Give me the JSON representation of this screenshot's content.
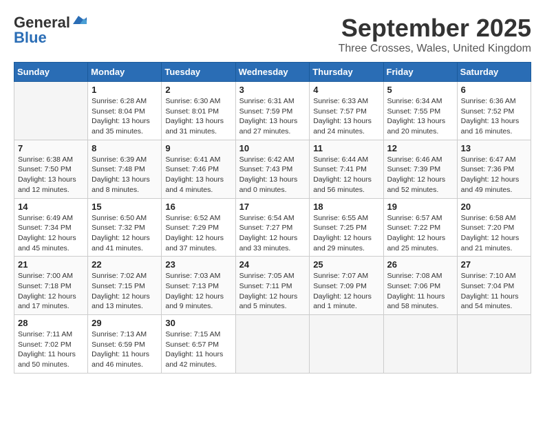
{
  "header": {
    "logo_line1": "General",
    "logo_line2": "Blue",
    "month": "September 2025",
    "location": "Three Crosses, Wales, United Kingdom"
  },
  "days_of_week": [
    "Sunday",
    "Monday",
    "Tuesday",
    "Wednesday",
    "Thursday",
    "Friday",
    "Saturday"
  ],
  "weeks": [
    [
      {
        "day": "",
        "info": ""
      },
      {
        "day": "1",
        "info": "Sunrise: 6:28 AM\nSunset: 8:04 PM\nDaylight: 13 hours\nand 35 minutes."
      },
      {
        "day": "2",
        "info": "Sunrise: 6:30 AM\nSunset: 8:01 PM\nDaylight: 13 hours\nand 31 minutes."
      },
      {
        "day": "3",
        "info": "Sunrise: 6:31 AM\nSunset: 7:59 PM\nDaylight: 13 hours\nand 27 minutes."
      },
      {
        "day": "4",
        "info": "Sunrise: 6:33 AM\nSunset: 7:57 PM\nDaylight: 13 hours\nand 24 minutes."
      },
      {
        "day": "5",
        "info": "Sunrise: 6:34 AM\nSunset: 7:55 PM\nDaylight: 13 hours\nand 20 minutes."
      },
      {
        "day": "6",
        "info": "Sunrise: 6:36 AM\nSunset: 7:52 PM\nDaylight: 13 hours\nand 16 minutes."
      }
    ],
    [
      {
        "day": "7",
        "info": "Sunrise: 6:38 AM\nSunset: 7:50 PM\nDaylight: 13 hours\nand 12 minutes."
      },
      {
        "day": "8",
        "info": "Sunrise: 6:39 AM\nSunset: 7:48 PM\nDaylight: 13 hours\nand 8 minutes."
      },
      {
        "day": "9",
        "info": "Sunrise: 6:41 AM\nSunset: 7:46 PM\nDaylight: 13 hours\nand 4 minutes."
      },
      {
        "day": "10",
        "info": "Sunrise: 6:42 AM\nSunset: 7:43 PM\nDaylight: 13 hours\nand 0 minutes."
      },
      {
        "day": "11",
        "info": "Sunrise: 6:44 AM\nSunset: 7:41 PM\nDaylight: 12 hours\nand 56 minutes."
      },
      {
        "day": "12",
        "info": "Sunrise: 6:46 AM\nSunset: 7:39 PM\nDaylight: 12 hours\nand 52 minutes."
      },
      {
        "day": "13",
        "info": "Sunrise: 6:47 AM\nSunset: 7:36 PM\nDaylight: 12 hours\nand 49 minutes."
      }
    ],
    [
      {
        "day": "14",
        "info": "Sunrise: 6:49 AM\nSunset: 7:34 PM\nDaylight: 12 hours\nand 45 minutes."
      },
      {
        "day": "15",
        "info": "Sunrise: 6:50 AM\nSunset: 7:32 PM\nDaylight: 12 hours\nand 41 minutes."
      },
      {
        "day": "16",
        "info": "Sunrise: 6:52 AM\nSunset: 7:29 PM\nDaylight: 12 hours\nand 37 minutes."
      },
      {
        "day": "17",
        "info": "Sunrise: 6:54 AM\nSunset: 7:27 PM\nDaylight: 12 hours\nand 33 minutes."
      },
      {
        "day": "18",
        "info": "Sunrise: 6:55 AM\nSunset: 7:25 PM\nDaylight: 12 hours\nand 29 minutes."
      },
      {
        "day": "19",
        "info": "Sunrise: 6:57 AM\nSunset: 7:22 PM\nDaylight: 12 hours\nand 25 minutes."
      },
      {
        "day": "20",
        "info": "Sunrise: 6:58 AM\nSunset: 7:20 PM\nDaylight: 12 hours\nand 21 minutes."
      }
    ],
    [
      {
        "day": "21",
        "info": "Sunrise: 7:00 AM\nSunset: 7:18 PM\nDaylight: 12 hours\nand 17 minutes."
      },
      {
        "day": "22",
        "info": "Sunrise: 7:02 AM\nSunset: 7:15 PM\nDaylight: 12 hours\nand 13 minutes."
      },
      {
        "day": "23",
        "info": "Sunrise: 7:03 AM\nSunset: 7:13 PM\nDaylight: 12 hours\nand 9 minutes."
      },
      {
        "day": "24",
        "info": "Sunrise: 7:05 AM\nSunset: 7:11 PM\nDaylight: 12 hours\nand 5 minutes."
      },
      {
        "day": "25",
        "info": "Sunrise: 7:07 AM\nSunset: 7:09 PM\nDaylight: 12 hours\nand 1 minute."
      },
      {
        "day": "26",
        "info": "Sunrise: 7:08 AM\nSunset: 7:06 PM\nDaylight: 11 hours\nand 58 minutes."
      },
      {
        "day": "27",
        "info": "Sunrise: 7:10 AM\nSunset: 7:04 PM\nDaylight: 11 hours\nand 54 minutes."
      }
    ],
    [
      {
        "day": "28",
        "info": "Sunrise: 7:11 AM\nSunset: 7:02 PM\nDaylight: 11 hours\nand 50 minutes."
      },
      {
        "day": "29",
        "info": "Sunrise: 7:13 AM\nSunset: 6:59 PM\nDaylight: 11 hours\nand 46 minutes."
      },
      {
        "day": "30",
        "info": "Sunrise: 7:15 AM\nSunset: 6:57 PM\nDaylight: 11 hours\nand 42 minutes."
      },
      {
        "day": "",
        "info": ""
      },
      {
        "day": "",
        "info": ""
      },
      {
        "day": "",
        "info": ""
      },
      {
        "day": "",
        "info": ""
      }
    ]
  ]
}
